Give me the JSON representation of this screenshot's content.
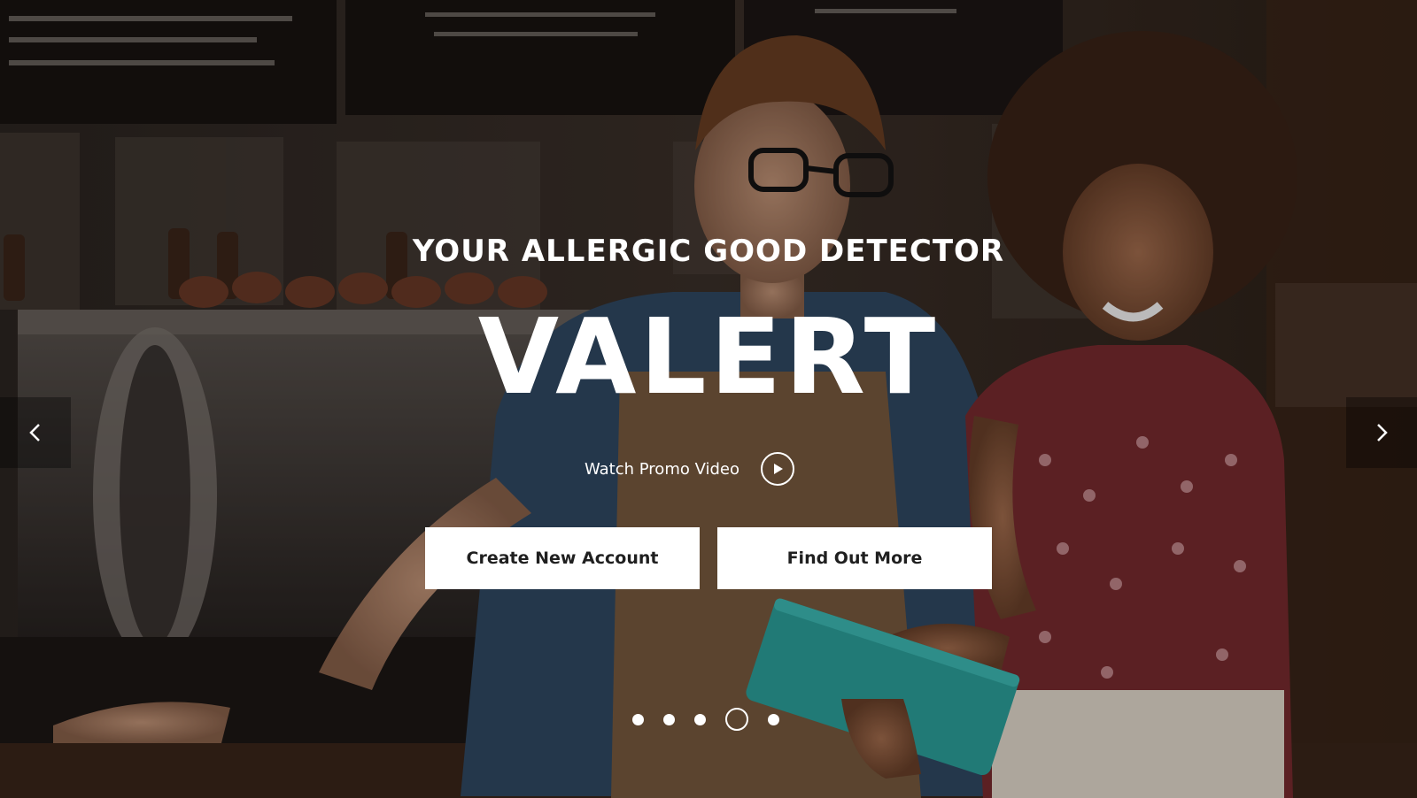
{
  "hero": {
    "eyebrow": "YOUR ALLERGIC GOOD DETECTOR",
    "brand": "VALERT",
    "promo_label": "Watch Promo Video",
    "play_icon": "play-icon"
  },
  "actions": {
    "create_label": "Create New Account",
    "more_label": "Find Out More"
  },
  "carousel": {
    "prev_icon": "chevron-left-icon",
    "next_icon": "chevron-right-icon",
    "slide_count": 5,
    "active_slide": 4
  },
  "colors": {
    "text": "#ffffff",
    "button_bg": "#ffffff",
    "button_text": "#1f1f1f",
    "accent_tablet": "#2aa7a1"
  }
}
